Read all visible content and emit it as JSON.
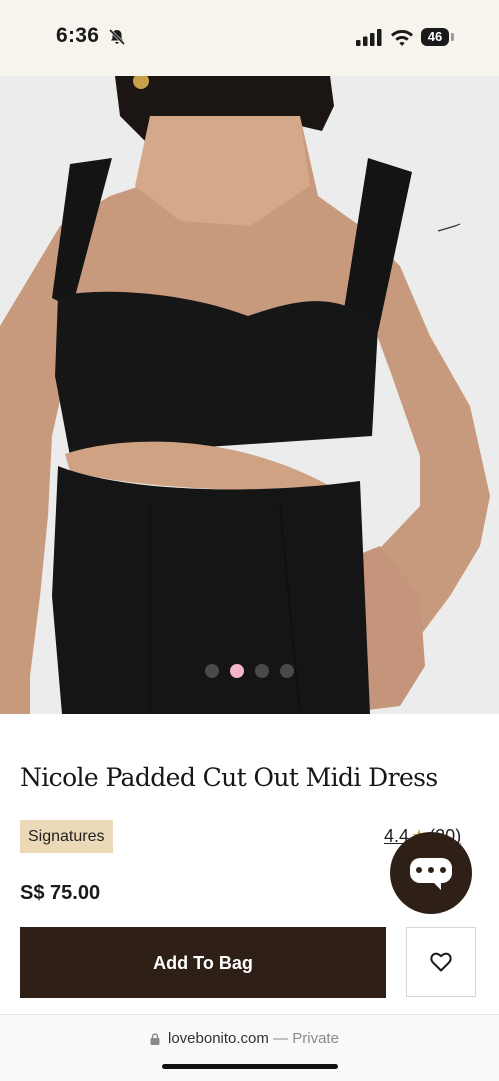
{
  "status_bar": {
    "time": "6:36",
    "battery": "46",
    "icons": [
      "bell-slash-icon",
      "signal-icon",
      "wifi-icon",
      "battery-icon"
    ]
  },
  "hero": {
    "image": "product-photo-black-dress",
    "carousel": {
      "count": 4,
      "active_index": 1
    }
  },
  "product": {
    "title": "Nicole Padded Cut Out Midi Dress",
    "badge": "Signatures",
    "rating": "4.4",
    "review_count": "(20)",
    "price": "S$ 75.00"
  },
  "actions": {
    "add_to_bag_label": "Add To Bag",
    "wishlist_icon": "heart-icon",
    "chat_icon": "chat-bubble-icon"
  },
  "browser": {
    "domain": "lovebonito.com",
    "separator": " — ",
    "mode": "Private",
    "lock_icon": "lock-icon"
  },
  "colors": {
    "brand_dark": "#2e2016",
    "badge_bg": "#ecd9b7",
    "active_dot": "#f4b5c8",
    "status_bg": "#f7f3ed"
  }
}
